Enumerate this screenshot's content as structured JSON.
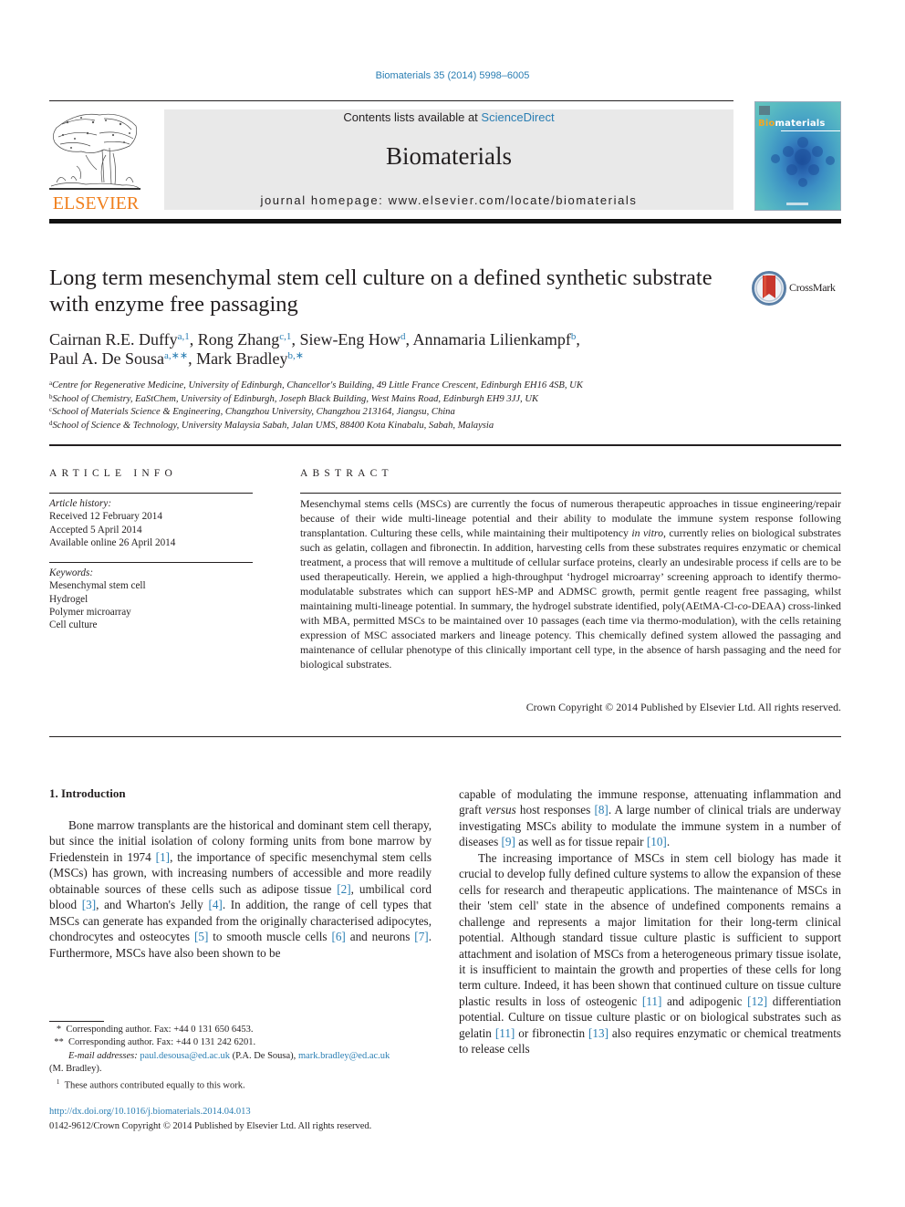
{
  "header": {
    "citation": "Biomaterials 35 (2014) 5998–6005",
    "contents_prefix": "Contents lists available at ",
    "contents_link": "ScienceDirect",
    "journal_name": "Biomaterials",
    "homepage_prefix": "journal homepage: ",
    "homepage_url": "www.elsevier.com/locate/biomaterials",
    "publisher_logo_text": "ELSEVIER",
    "cover_title_highlight": "Bio",
    "cover_title_rest": "materials",
    "brand_orange": "#f07f1c",
    "link_color": "#2a7eb3"
  },
  "article": {
    "title": "Long term mesenchymal stem cell culture on a defined synthetic substrate with enzyme free passaging",
    "crossmark_label": "CrossMark",
    "authors": [
      {
        "name": "Cairnan R.E. Duffy",
        "sup": "a,1",
        "sep": ", "
      },
      {
        "name": "Rong Zhang",
        "sup": "c,1",
        "sep": ", "
      },
      {
        "name": "Siew-Eng How",
        "sup": "d",
        "sep": ", "
      },
      {
        "name": "Annamaria Lilienkampf",
        "sup": "b",
        "sep": ","
      },
      {
        "name": "Paul A. De Sousa",
        "sup": "a,∗∗",
        "sep": ", "
      },
      {
        "name": "Mark Bradley",
        "sup": "b,∗",
        "sep": ""
      }
    ],
    "affiliations": [
      {
        "key": "a",
        "text": "Centre for Regenerative Medicine, University of Edinburgh, Chancellor's Building, 49 Little France Crescent, Edinburgh EH16 4SB, UK"
      },
      {
        "key": "b",
        "text": "School of Chemistry, EaStChem, University of Edinburgh, Joseph Black Building, West Mains Road, Edinburgh EH9 3JJ, UK"
      },
      {
        "key": "c",
        "text": "School of Materials Science & Engineering, Changzhou University, Changzhou 213164, Jiangsu, China"
      },
      {
        "key": "d",
        "text": "School of Science & Technology, University Malaysia Sabah, Jalan UMS, 88400 Kota Kinabalu, Sabah, Malaysia"
      }
    ]
  },
  "article_info": {
    "heading": "ARTICLE INFO",
    "history_label": "Article history:",
    "history": [
      "Received 12 February 2014",
      "Accepted 5 April 2014",
      "Available online 26 April 2014"
    ],
    "keywords_label": "Keywords:",
    "keywords": [
      "Mesenchymal stem cell",
      "Hydrogel",
      "Polymer microarray",
      "Cell culture"
    ]
  },
  "abstract": {
    "heading": "ABSTRACT",
    "parts": [
      {
        "t": "Mesenchymal stems cells (MSCs) are currently the focus of numerous therapeutic approaches in tissue engineering/repair because of their wide multi-lineage potential and their ability to modulate the im­mune system response following transplantation. Culturing these cells, while maintaining their multi­potency ",
        "i": false
      },
      {
        "t": "in vitro",
        "i": true
      },
      {
        "t": ", currently relies on biological substrates such as gelatin, collagen and fibronectin. In addition, harvesting cells from these substrates requires enzymatic or chemical treatment, a process that will remove a multitude of cellular surface proteins, clearly an undesirable process if cells are to be used therapeutically. Herein, we applied a high-throughput ‘hydrogel microarray’ screening approach to identify thermo-modulatable substrates which can support hES-MP and ADMSC growth, permit gentle reagent free passaging, whilst maintaining multi-lineage potential. In summary, the hydrogel substrate identified, poly(AEtMA-Cl-",
        "i": false
      },
      {
        "t": "co",
        "i": true
      },
      {
        "t": "-DEAA) cross-linked with MBA, permitted MSCs to be maintained over 10 passages (each time via thermo-modulation), with the cells retaining expression of MSC associated markers and lineage potency. This chemically defined system allowed the passaging and maintenance of cellular phenotype of this clinically important cell type, in the absence of harsh passaging and the need for biological substrates.",
        "i": false
      }
    ],
    "copyright": "Crown Copyright © 2014 Published by Elsevier Ltd. All rights reserved."
  },
  "body": {
    "section_heading": "1.  Introduction",
    "left_paragraph": [
      {
        "t": "Bone marrow transplants are the historical and dominant stem cell therapy, but since the initial isolation of colony forming units from bone marrow by Friedenstein in 1974 "
      },
      {
        "ref": "[1]"
      },
      {
        "t": ", the importance of specific mesenchymal stem cells (MSCs) has grown, with increasing numbers of accessible and more readily obtainable sources of these cells such as adipose tissue "
      },
      {
        "ref": "[2]"
      },
      {
        "t": ", umbilical cord blood "
      },
      {
        "ref": "[3]"
      },
      {
        "t": ", and Wharton's Jelly "
      },
      {
        "ref": "[4]"
      },
      {
        "t": ". In addition, the range of cell types that MSCs can generate has expanded from the originally characterised adi­pocytes, chondrocytes and osteocytes "
      },
      {
        "ref": "[5]"
      },
      {
        "t": " to smooth muscle cells "
      },
      {
        "ref": "[6]"
      },
      {
        "t": " and neurons "
      },
      {
        "ref": "[7]"
      },
      {
        "t": ". Furthermore, MSCs have also been shown to be"
      }
    ],
    "right_paragraph_1": [
      {
        "t": "capable of modulating the immune response, attenuating inflam­mation and graft "
      },
      {
        "i": "versus"
      },
      {
        "t": " host responses "
      },
      {
        "ref": "[8]"
      },
      {
        "t": ". A large number of clinical trials are underway investigating MSCs ability to modulate the immune system in a number of diseases "
      },
      {
        "ref": "[9]"
      },
      {
        "t": " as well as for tissue repair "
      },
      {
        "ref": "[10]"
      },
      {
        "t": "."
      }
    ],
    "right_paragraph_2": [
      {
        "t": "The increasing importance of MSCs in stem cell biology has made it crucial to develop fully defined culture systems to allow the expansion of these cells for research and therapeutic applications. The maintenance of MSCs in their 'stem cell' state in the absence of undefined components remains a challenge and represents a major limitation for their long-term clinical potential. Although standard tissue culture plastic is sufficient to support attachment and isolation of MSCs from a heterogeneous primary tissue isolate, it is insufficient to maintain the growth and properties of these cells for long term culture. Indeed, it has been shown that continued culture on tissue culture plastic results in loss of osteogenic "
      },
      {
        "ref": "[11]"
      },
      {
        "t": " and adi­pogenic "
      },
      {
        "ref": "[12]"
      },
      {
        "t": " differentiation potential. Culture on tissue culture plastic or on biological substrates such as gelatin "
      },
      {
        "ref": "[11]"
      },
      {
        "t": " or fibronectin "
      },
      {
        "ref": "[13]"
      },
      {
        "t": " also requires enzymatic or chemical treatments to release cells"
      }
    ]
  },
  "footnotes": {
    "star1_mark": "*",
    "star1_text": "Corresponding author. Fax: +44 0 131 650 6453.",
    "star2_mark": "**",
    "star2_text": "Corresponding author. Fax: +44 0 131 242 6201.",
    "email_label": "E-mail addresses: ",
    "email1": "paul.desousa@ed.ac.uk",
    "email1_owner": " (P.A. De Sousa), ",
    "email2": "mark.bradley@ed.ac.uk",
    "email2_owner": "(M. Bradley).",
    "equal_mark": "1",
    "equal_text": "These authors contributed equally to this work.",
    "doi": "http://dx.doi.org/10.1016/j.biomaterials.2014.04.013",
    "issn_line": "0142-9612/Crown Copyright © 2014 Published by Elsevier Ltd. All rights reserved."
  }
}
